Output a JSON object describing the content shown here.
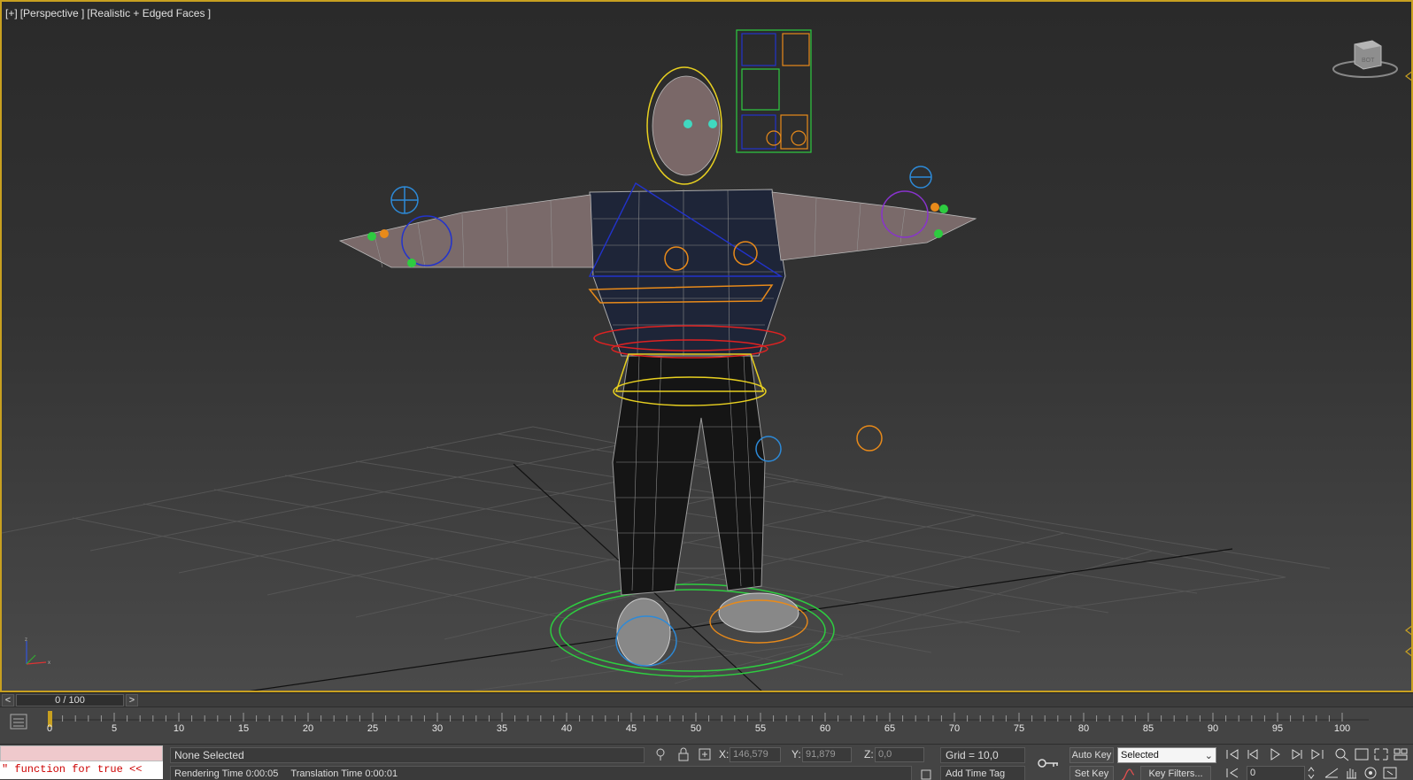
{
  "viewport": {
    "label_parts": [
      "[+]",
      "[Perspective ]",
      "[Realistic + Edged Faces ]"
    ],
    "viewcube_face": "BOT"
  },
  "time_slider": {
    "prev": "<",
    "next": ">",
    "position": "0 / 100",
    "current_frame": 0,
    "total_frames": 100
  },
  "trackbar": {
    "ticks": [
      "0",
      "5",
      "10",
      "15",
      "20",
      "25",
      "30",
      "35",
      "40",
      "45",
      "50",
      "55",
      "60",
      "65",
      "70",
      "75",
      "80",
      "85",
      "90",
      "95",
      "100"
    ]
  },
  "status": {
    "maxscript_output": "\" function for true <<",
    "selection": "None Selected",
    "rendering_time": "Rendering Time  0:00:05",
    "translation_time": "Translation Time  0:00:01",
    "x_label": "X:",
    "x_value": "146,579",
    "y_label": "Y:",
    "y_value": "91,879",
    "z_label": "Z:",
    "z_value": "0,0",
    "grid": "Grid = 10,0",
    "add_time_tag": "Add Time Tag",
    "auto_key": "Auto Key",
    "set_key": "Set Key",
    "key_mode": "Selected",
    "key_filters": "Key Filters...",
    "frame_value": "0"
  },
  "colors": {
    "viewport_border": "#c8a020",
    "maxscript_bg": "#efc9cc",
    "maxscript_text": "#cc0000"
  }
}
